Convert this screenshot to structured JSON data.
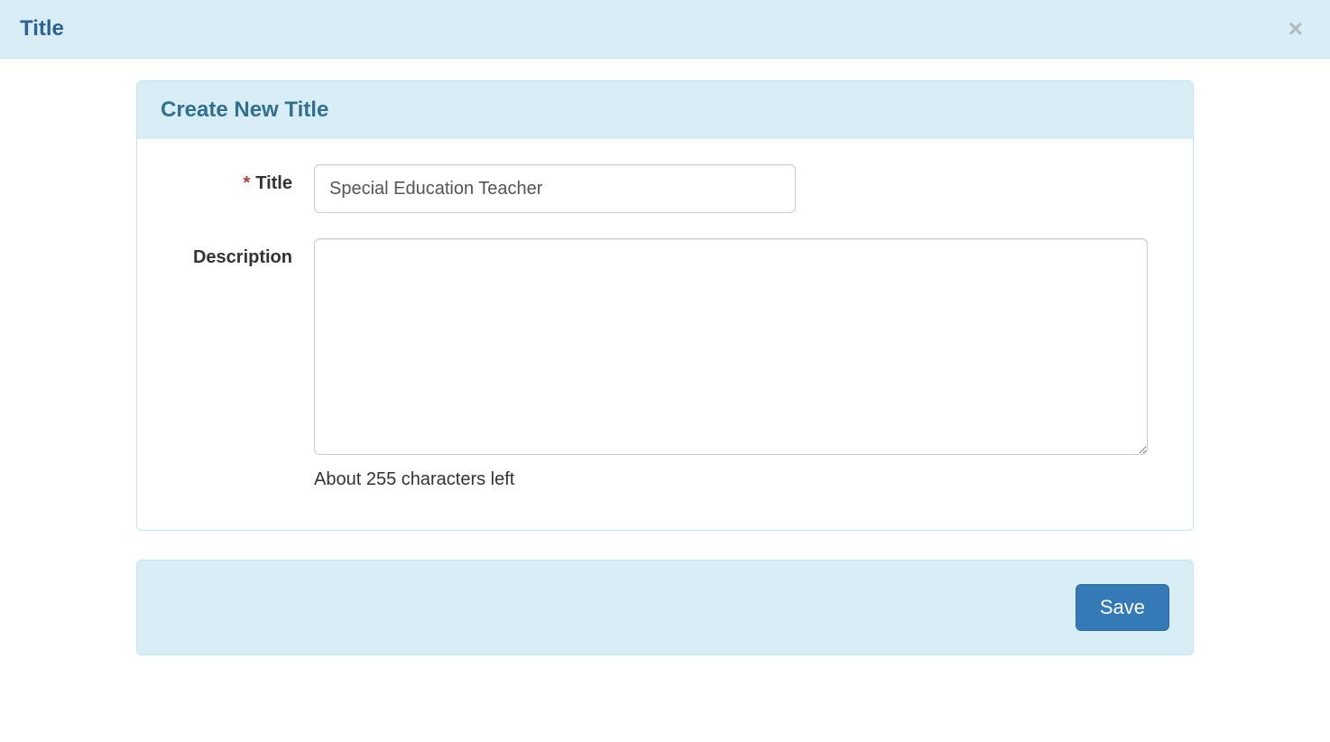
{
  "header": {
    "title": "Title",
    "close_label": "×"
  },
  "panel": {
    "heading": "Create New Title",
    "fields": {
      "title": {
        "label": "Title",
        "required_mark": "*",
        "value": "Special Education Teacher"
      },
      "description": {
        "label": "Description",
        "value": "",
        "help_text": "About 255 characters left"
      }
    }
  },
  "footer": {
    "save_label": "Save"
  }
}
